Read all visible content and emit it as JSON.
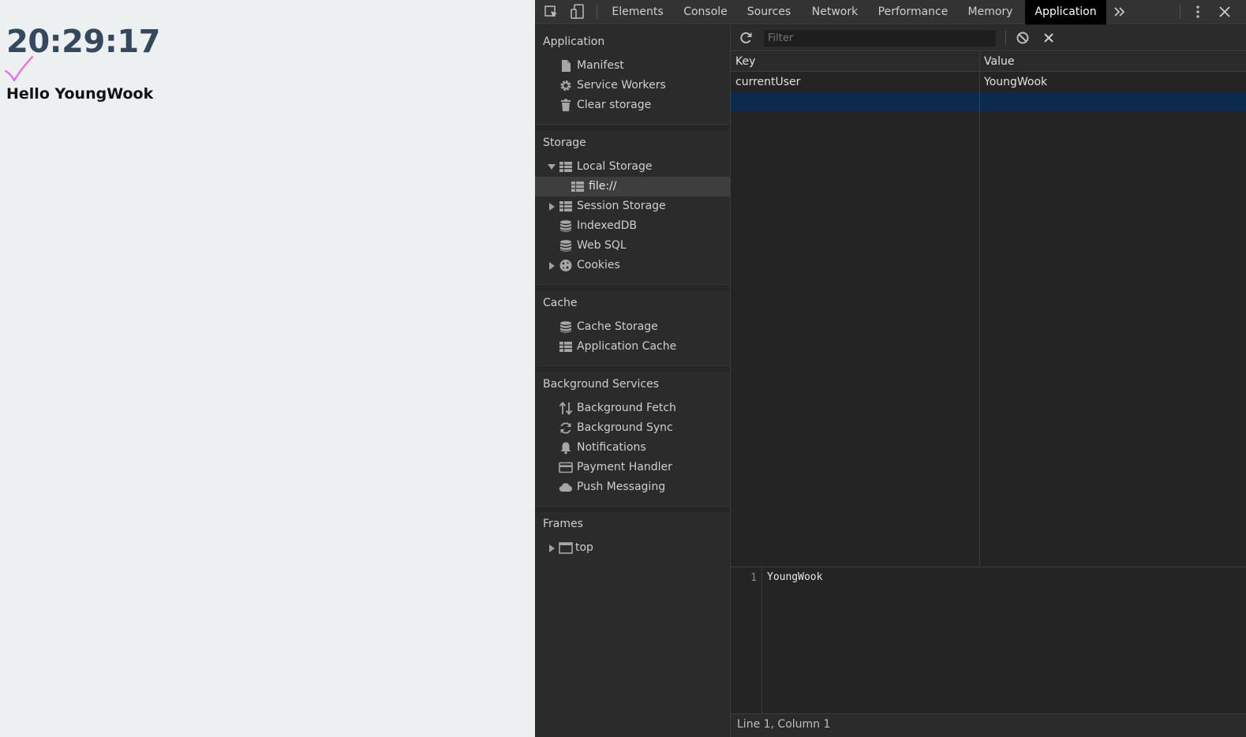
{
  "page": {
    "clock": "20:29:17",
    "greeting": "Hello YoungWook"
  },
  "devtools": {
    "tabs": [
      {
        "label": "Elements"
      },
      {
        "label": "Console"
      },
      {
        "label": "Sources"
      },
      {
        "label": "Network"
      },
      {
        "label": "Performance"
      },
      {
        "label": "Memory"
      },
      {
        "label": "Application",
        "active": true
      }
    ],
    "sidebar": {
      "application": {
        "title": "Application",
        "items": [
          {
            "label": "Manifest",
            "icon": "file-icon"
          },
          {
            "label": "Service Workers",
            "icon": "gear-icon"
          },
          {
            "label": "Clear storage",
            "icon": "trash-icon"
          }
        ]
      },
      "storage": {
        "title": "Storage",
        "items": [
          {
            "label": "Local Storage",
            "icon": "table-icon",
            "expanded": true
          },
          {
            "label": "file://",
            "icon": "table-icon",
            "selected": true
          },
          {
            "label": "Session Storage",
            "icon": "table-icon",
            "expanded": false
          },
          {
            "label": "IndexedDB",
            "icon": "database-icon"
          },
          {
            "label": "Web SQL",
            "icon": "database-icon"
          },
          {
            "label": "Cookies",
            "icon": "cookie-icon",
            "expanded": false
          }
        ]
      },
      "cache": {
        "title": "Cache",
        "items": [
          {
            "label": "Cache Storage",
            "icon": "database-icon"
          },
          {
            "label": "Application Cache",
            "icon": "table-icon"
          }
        ]
      },
      "background": {
        "title": "Background Services",
        "items": [
          {
            "label": "Background Fetch",
            "icon": "up-down-arrows-icon"
          },
          {
            "label": "Background Sync",
            "icon": "sync-icon"
          },
          {
            "label": "Notifications",
            "icon": "bell-icon"
          },
          {
            "label": "Payment Handler",
            "icon": "card-icon"
          },
          {
            "label": "Push Messaging",
            "icon": "cloud-icon"
          }
        ]
      },
      "frames": {
        "title": "Frames",
        "items": [
          {
            "label": "top",
            "icon": "frame-icon",
            "expanded": false
          }
        ]
      }
    },
    "filter": {
      "placeholder": "Filter",
      "value": ""
    },
    "grid": {
      "columns": [
        "Key",
        "Value"
      ],
      "rows": [
        {
          "key": "currentUser",
          "value": "YoungWook"
        }
      ]
    },
    "editor": {
      "line_number": "1",
      "content": "YoungWook"
    },
    "status": "Line 1, Column 1",
    "colors": {
      "selected_row": "#0c2a4d",
      "active_tab": "#000000",
      "clock": "#34495e",
      "checkmark": "#ee66ee"
    }
  }
}
